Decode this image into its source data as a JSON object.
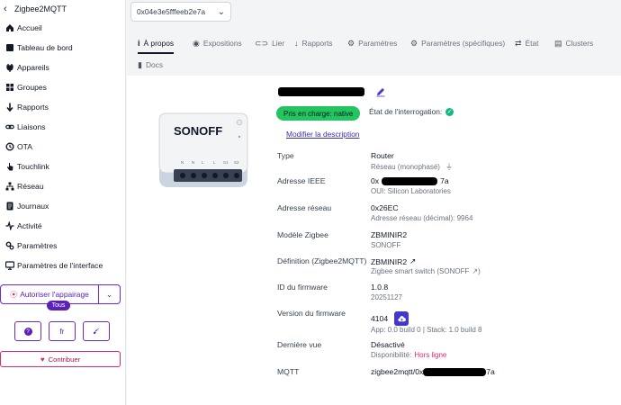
{
  "app": {
    "title": "Zigbee2MQTT"
  },
  "sidebar": {
    "items": [
      {
        "label": "Accueil",
        "icon": "home-icon"
      },
      {
        "label": "Tableau de bord",
        "icon": "dashboard-icon"
      },
      {
        "label": "Appareils",
        "icon": "plug-icon"
      },
      {
        "label": "Groupes",
        "icon": "groups-icon"
      },
      {
        "label": "Rapports",
        "icon": "arrow-down-icon"
      },
      {
        "label": "Liaisons",
        "icon": "link-icon"
      },
      {
        "label": "OTA",
        "icon": "ota-icon"
      },
      {
        "label": "Touchlink",
        "icon": "touch-icon"
      },
      {
        "label": "Réseau",
        "icon": "network-icon"
      },
      {
        "label": "Journaux",
        "icon": "logs-icon"
      },
      {
        "label": "Activité",
        "icon": "activity-icon"
      },
      {
        "label": "Paramètres",
        "icon": "gear-icon"
      },
      {
        "label": "Paramètres de l'interface",
        "icon": "monitor-icon"
      }
    ],
    "pairing_label": "Autoriser l'appairage",
    "pairing_target": "Tous",
    "lang_label": "fr",
    "contribute_label": "Contribuer"
  },
  "device_select": {
    "value": "0x04e3e5fffeeb2e7a"
  },
  "tabs": [
    {
      "label": "À propos",
      "icon": "info-icon",
      "active": true
    },
    {
      "label": "Expositions",
      "icon": "eye-icon"
    },
    {
      "label": "Lier",
      "icon": "link-icon"
    },
    {
      "label": "Rapports",
      "icon": "arrow-down-icon"
    },
    {
      "label": "Paramètres",
      "icon": "settings-icon"
    },
    {
      "label": "Paramètres (spécifiques)",
      "icon": "gear-icon"
    },
    {
      "label": "État",
      "icon": "state-icon"
    },
    {
      "label": "Clusters",
      "icon": "clusters-icon"
    },
    {
      "label": "Docs",
      "icon": "docs-icon"
    }
  ],
  "device": {
    "brand_label": "SONOFF",
    "supported_badge": "Pris en charge: native",
    "interview_label": "État de l'interrogation:",
    "modify_description": "Modifier la description",
    "fields": [
      {
        "label": "Type",
        "value": "Router",
        "sub": "Réseau (monophasé)"
      },
      {
        "label": "Adresse IEEE",
        "value_prefix": "0x",
        "value_suffix": "7a",
        "sub": "OUI: Silicon Laboratories"
      },
      {
        "label": "Adresse réseau",
        "value": "0x26EC",
        "sub": "Adresse réseau (décimal): 9964"
      },
      {
        "label": "Modèle Zigbee",
        "value": "ZBMINIR2",
        "sub": "SONOFF"
      },
      {
        "label": "Définition (Zigbee2MQTT)",
        "value": "ZBMINIR2",
        "sub": "Zigbee smart switch (SONOFF"
      },
      {
        "label": "ID du firmware",
        "value": "1.0.8",
        "sub": "20251127"
      },
      {
        "label": "Version du firmware",
        "value": "4104",
        "sub": "App: 0.0 build 0 | Stack: 1.0 build 8"
      },
      {
        "label": "Dernière vue",
        "value": "Désactivé",
        "sub_prefix": "Disponibilité:",
        "sub_link": "Hors ligne"
      },
      {
        "label": "MQTT",
        "value_prefix": "zigbee2mqtt/0x",
        "value_suffix": "7a"
      }
    ]
  },
  "colors": {
    "accent": "#5b21b6",
    "success": "#22c55e",
    "link": "#3730a3",
    "pink": "#db2777"
  }
}
